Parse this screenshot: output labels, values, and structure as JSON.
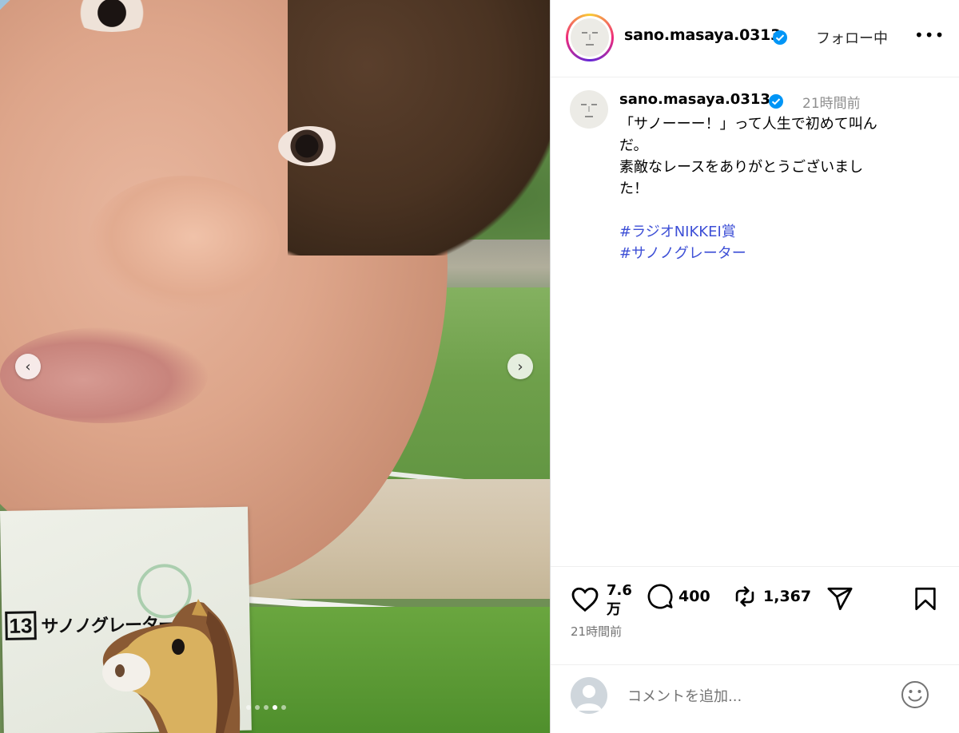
{
  "post": {
    "username": "sano.masaya.0313",
    "follow_label": "フォロー中",
    "more_label": "•••"
  },
  "media": {
    "ticket_number": "13",
    "ticket_horse": "サノノグレーター",
    "slide_count": 5,
    "active_slide": 4
  },
  "caption": {
    "username": "sano.masaya.0313",
    "time": "21時間前",
    "lines": [
      "「サノーーー！」って人生で初めて叫ん",
      "だ。",
      "素敵なレースをありがとうございまし",
      "た！"
    ],
    "hashtags": [
      "#ラジオNIKKEI賞",
      "#サノノグレーター"
    ]
  },
  "actions": {
    "likes_top": "7.6",
    "likes_bottom": "万",
    "comments": "400",
    "reposts": "1,367"
  },
  "footer": {
    "time": "21時間前",
    "comment_placeholder": "コメントを追加..."
  },
  "colors": {
    "hashtag": "#3d4fd6",
    "verified": "#0095f6"
  }
}
